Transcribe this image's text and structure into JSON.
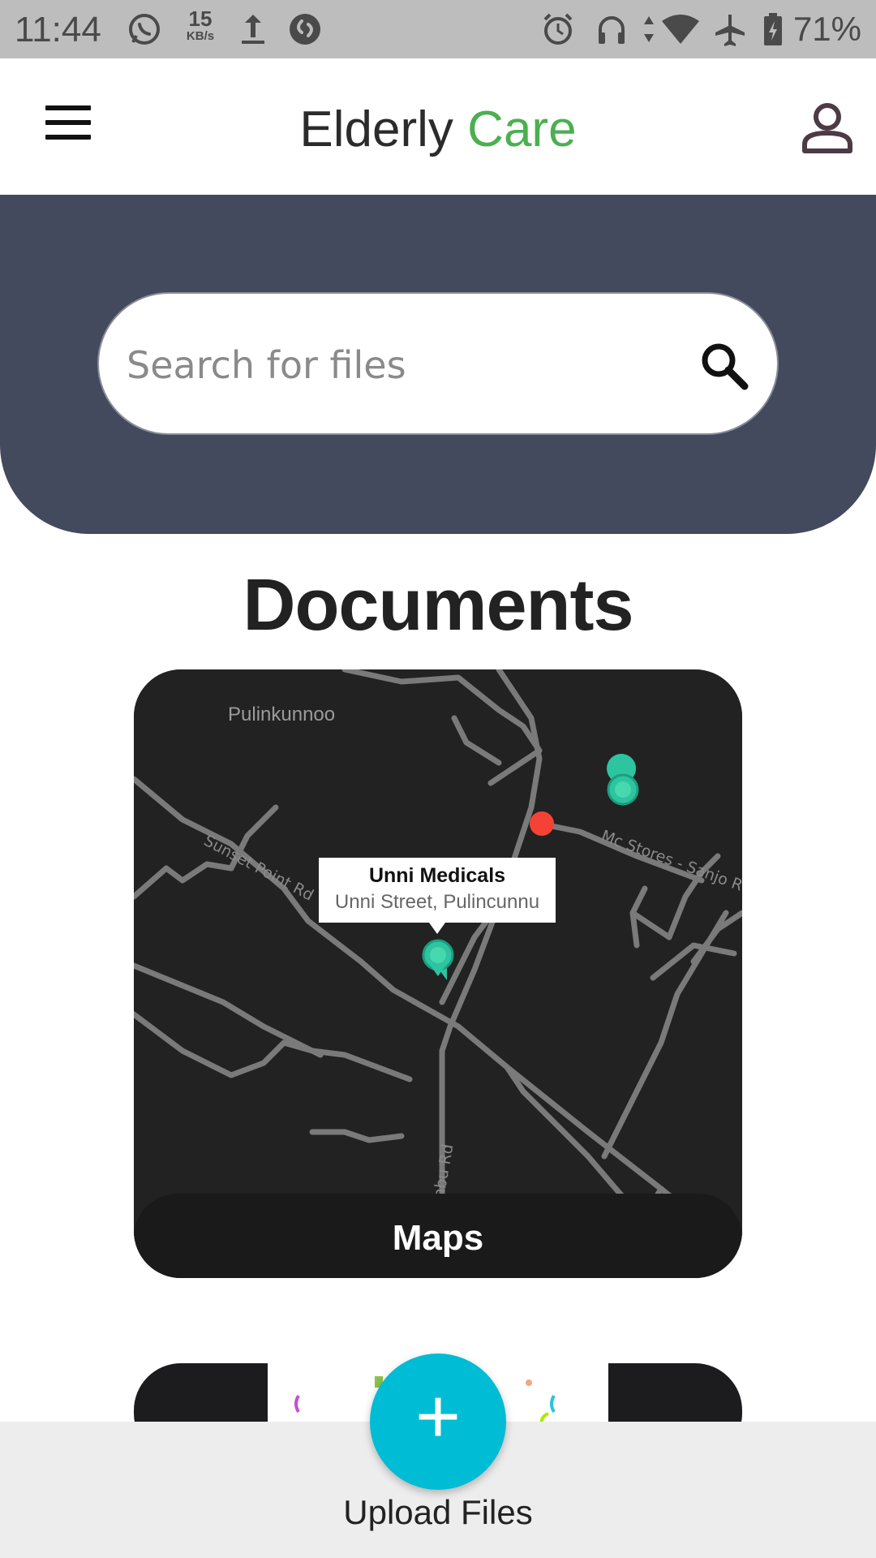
{
  "status_bar": {
    "time": "11:44",
    "net_speed_value": "15",
    "net_speed_unit": "KB/s",
    "battery": "71%",
    "icons": [
      "whatsapp-icon",
      "upload-icon",
      "shazam-icon",
      "alarm-icon",
      "headset-icon",
      "data-arrows-icon",
      "wifi-icon",
      "airplane-icon",
      "battery-icon"
    ]
  },
  "app_bar": {
    "title_main": "Elderly ",
    "title_accent": "Care",
    "accent_color": "#4caf50",
    "icons": [
      "menu-icon",
      "profile-icon"
    ]
  },
  "search": {
    "placeholder": "Search for files",
    "value": ""
  },
  "section": {
    "title": "Documents"
  },
  "cards": [
    {
      "label": "Maps",
      "map": {
        "town": "Pulinkunnoo",
        "roads": [
          "Sunset Point Rd",
          "Mc Stores - Sanjo Rd",
          "Mankombu Rd"
        ],
        "marker": {
          "name": "Unni Medicals",
          "address": "Unni Street, Pulincunnu"
        }
      }
    }
  ],
  "fab": {
    "symbol": "+",
    "label": "Upload Files",
    "color": "#00bcd4"
  },
  "colors": {
    "hero": "#434a5e",
    "map_background": "#222222"
  }
}
